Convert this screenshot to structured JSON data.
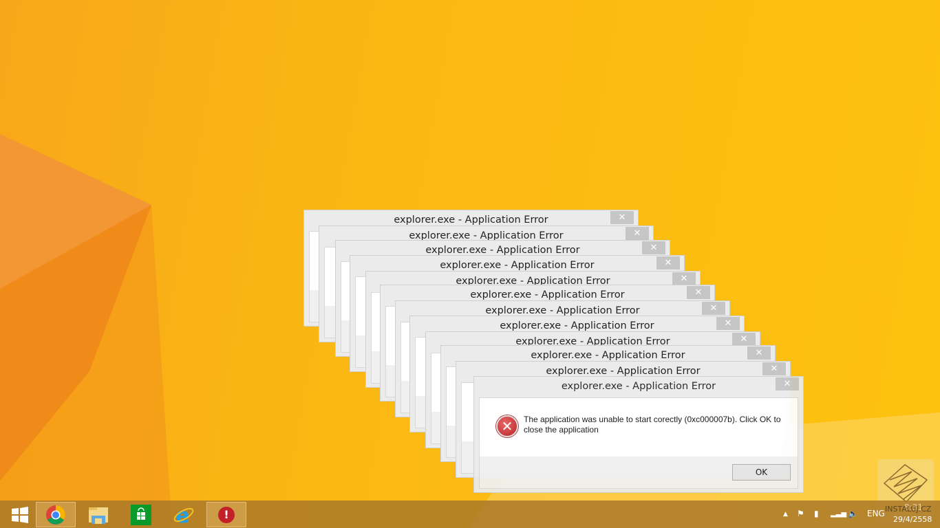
{
  "dialogs": {
    "title": "explorer.exe - Application Error",
    "close_glyph": "✕",
    "message": "The application was unable to start corectly (0xc000007b). Click OK to close the application",
    "ok_label": "OK",
    "count": 12
  },
  "taskbar": {
    "items": [
      {
        "name": "start",
        "icon": "windows-logo-icon"
      },
      {
        "name": "chrome",
        "icon": "chrome-icon"
      },
      {
        "name": "file-explorer",
        "icon": "folder-icon"
      },
      {
        "name": "store",
        "icon": "store-icon"
      },
      {
        "name": "internet-explorer",
        "icon": "ie-icon"
      },
      {
        "name": "error-app",
        "icon": "error-icon"
      }
    ],
    "language": "ENG",
    "time": "8:31",
    "date": "29/4/2558"
  },
  "watermark": "INSTALUJ.CZ",
  "colors": {
    "accent": "#fbb812",
    "taskbar": "#aa7828"
  }
}
